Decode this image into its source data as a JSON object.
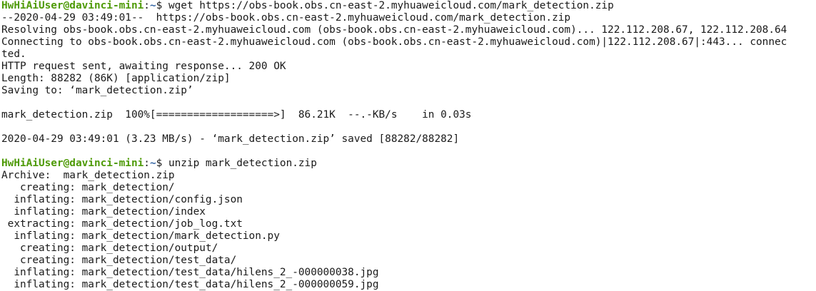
{
  "terminal": {
    "prompt": {
      "user_host": "HwHiAiUser@davinci-mini",
      "path": "~",
      "symbol": "$ "
    },
    "command_wget": "wget https://obs-book.obs.cn-east-2.myhuaweicloud.com/mark_detection.zip",
    "wget_output": [
      "--2020-04-29 03:49:01--  https://obs-book.obs.cn-east-2.myhuaweicloud.com/mark_detection.zip",
      "Resolving obs-book.obs.cn-east-2.myhuaweicloud.com (obs-book.obs.cn-east-2.myhuaweicloud.com)... 122.112.208.67, 122.112.208.64",
      "Connecting to obs-book.obs.cn-east-2.myhuaweicloud.com (obs-book.obs.cn-east-2.myhuaweicloud.com)|122.112.208.67|:443... connec",
      "ted.",
      "HTTP request sent, awaiting response... 200 OK",
      "Length: 88282 (86K) [application/zip]",
      "Saving to: ‘mark_detection.zip’"
    ],
    "progress_line": "mark_detection.zip  100%[===================>]  86.21K  --.-KB/s    in 0.03s",
    "saved_line": "2020-04-29 03:49:01 (3.23 MB/s) - ‘mark_detection.zip’ saved [88282/88282]",
    "command_unzip": "unzip mark_detection.zip",
    "unzip_output": [
      "Archive:  mark_detection.zip",
      "   creating: mark_detection/",
      "  inflating: mark_detection/config.json",
      "  inflating: mark_detection/index",
      " extracting: mark_detection/job_log.txt",
      "  inflating: mark_detection/mark_detection.py",
      "   creating: mark_detection/output/",
      "   creating: mark_detection/test_data/",
      "  inflating: mark_detection/test_data/hilens_2_-000000038.jpg",
      "  inflating: mark_detection/test_data/hilens_2_-000000059.jpg"
    ]
  }
}
